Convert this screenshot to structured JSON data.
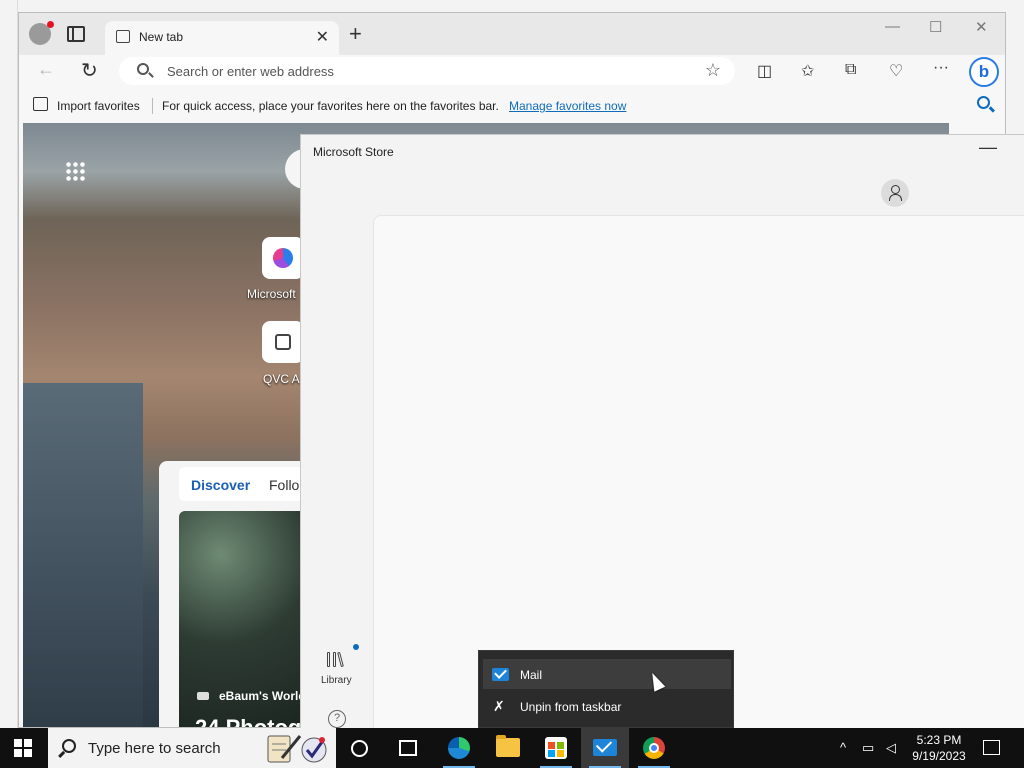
{
  "browser": {
    "tab": {
      "title": "New tab",
      "close": "✕"
    },
    "new_tab": "+",
    "window_controls": {
      "minimize": "—",
      "maximize": "☐",
      "close": "✕"
    },
    "address_bar": {
      "placeholder": "Search or enter web address"
    },
    "favorites_bar": {
      "import_label": "Import favorites",
      "message": "For quick access, place your favorites here on the favorites bar.",
      "manage_link": "Manage favorites now"
    },
    "toolbar_icons": [
      "split-screen-icon",
      "favorites-icon",
      "collections-icon",
      "browser-essentials-icon",
      "more-icon",
      "bing-icon"
    ],
    "bing_label": "b"
  },
  "newtab": {
    "top_sites": [
      {
        "label": "Microsoft"
      },
      {
        "label": "QVC A"
      }
    ],
    "feed": {
      "tabs": [
        "Discover",
        "Follo"
      ],
      "card_source": "eBaum's World",
      "card_title": "24 Photog"
    }
  },
  "store": {
    "title": "Microsoft Store",
    "minimize": "—",
    "library_label": "Library",
    "help": "?"
  },
  "jump_list": {
    "items": [
      {
        "label": "Mail"
      },
      {
        "label": "Unpin from taskbar"
      }
    ]
  },
  "taskbar": {
    "search_placeholder": "Type here to search",
    "apps": [
      "edge",
      "file-explorer",
      "microsoft-store",
      "mail",
      "chrome"
    ],
    "clock": {
      "time": "5:23 PM",
      "date": "9/19/2023"
    }
  },
  "colors": {
    "accent": "#0f6cbd",
    "taskbar": "#101010",
    "jump_list": "#2b2b2b"
  }
}
